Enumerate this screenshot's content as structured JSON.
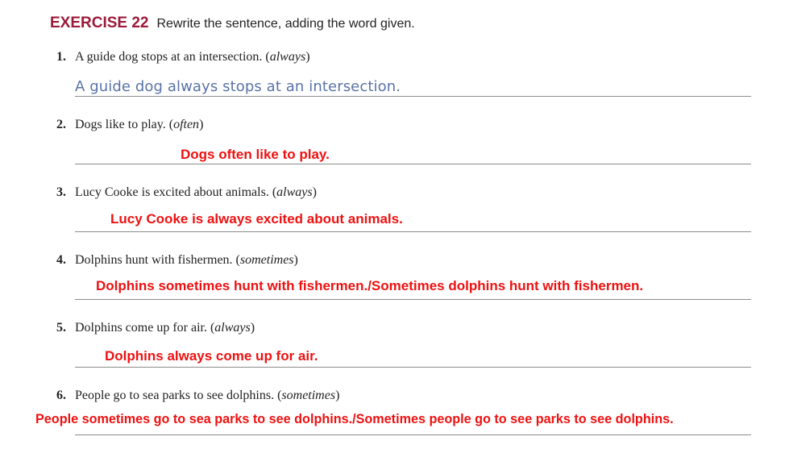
{
  "exercise": {
    "title": "EXERCISE 22",
    "instruction": "Rewrite the sentence, adding the word given."
  },
  "items": [
    {
      "number": "1.",
      "sentence": "A guide dog stops at an intersection.",
      "word": "always",
      "answer": "A guide dog always stops at an intersection."
    },
    {
      "number": "2.",
      "sentence": "Dogs like to play.",
      "word": "often",
      "answer": "Dogs often like to play."
    },
    {
      "number": "3.",
      "sentence": "Lucy Cooke is excited about animals.",
      "word": "always",
      "answer": "Lucy Cooke is always excited about animals."
    },
    {
      "number": "4.",
      "sentence": "Dolphins hunt with fishermen.",
      "word": "sometimes",
      "answer": "Dolphins sometimes hunt with fishermen./Sometimes dolphins hunt with fishermen."
    },
    {
      "number": "5.",
      "sentence": "Dolphins come up for air.",
      "word": "always",
      "answer": "Dolphins always come up for air."
    },
    {
      "number": "6.",
      "sentence": "People go to sea parks to see dolphins.",
      "word": "sometimes",
      "answer": "People sometimes go to sea parks to see dolphins./Sometimes people go to see parks to see dolphins."
    }
  ],
  "colors": {
    "title": "#9b1b3a",
    "handwriting": "#5a73a8",
    "answer_red": "#ee1111"
  }
}
